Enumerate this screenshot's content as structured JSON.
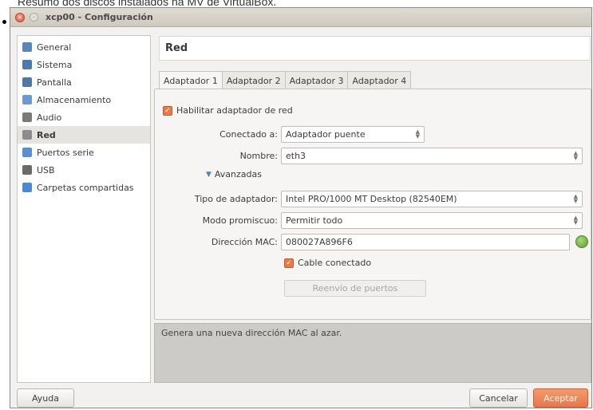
{
  "caption": "Resumo dos discos instalados na MV de VirtualBox.",
  "window": {
    "title": "xcp00 - Configuración",
    "close_glyph": "×",
    "min_glyph": "–"
  },
  "sidebar": {
    "items": [
      {
        "label": "General",
        "icon": "general-icon",
        "color": "#5b84b8"
      },
      {
        "label": "Sistema",
        "icon": "system-icon",
        "color": "#4a7ab0"
      },
      {
        "label": "Pantalla",
        "icon": "display-icon",
        "color": "#4f76a8"
      },
      {
        "label": "Almacenamiento",
        "icon": "storage-icon",
        "color": "#6c9ad0"
      },
      {
        "label": "Audio",
        "icon": "audio-icon",
        "color": "#7a7a7a"
      },
      {
        "label": "Red",
        "icon": "network-icon",
        "color": "#8c8c8c",
        "selected": true
      },
      {
        "label": "Puertos serie",
        "icon": "serial-ports-icon",
        "color": "#5a8fd0"
      },
      {
        "label": "USB",
        "icon": "usb-icon",
        "color": "#6a6a6a"
      },
      {
        "label": "Carpetas compartidas",
        "icon": "shared-folders-icon",
        "color": "#4a8ad4"
      }
    ]
  },
  "header": {
    "title": "Red"
  },
  "tabs": [
    "Adaptador 1",
    "Adaptador 2",
    "Adaptador 3",
    "Adaptador 4"
  ],
  "adapter": {
    "enable_label": "Habilitar adaptador de red",
    "attached_label": "Conectado a:",
    "attached_value": "Adaptador puente",
    "name_label": "Nombre:",
    "name_value": "eth3",
    "advanced_label": "Avanzadas",
    "adapter_type_label": "Tipo de adaptador:",
    "adapter_type_value": "Intel PRO/1000 MT Desktop (82540EM)",
    "promisc_label": "Modo promiscuo:",
    "promisc_value": "Permitir todo",
    "mac_label": "Dirección MAC:",
    "mac_value": "080027A896F6",
    "cable_label": "Cable conectado",
    "port_forward_label": "Reenvío de puertos"
  },
  "info": {
    "text": "Genera una nueva dirección MAC al azar."
  },
  "buttons": {
    "help": "Ayuda",
    "cancel": "Cancelar",
    "accept": "Aceptar"
  },
  "colors": {
    "accent": "#e8774a",
    "mac_button": "#6aa83a"
  }
}
